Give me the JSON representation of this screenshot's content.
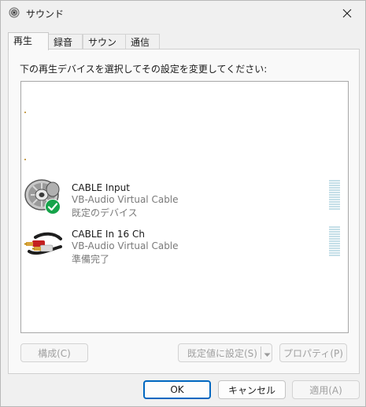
{
  "window": {
    "title": "サウンド",
    "title_icon": "speaker-icon",
    "close_icon": "close-icon"
  },
  "tabs": [
    {
      "label": "再生",
      "active": true
    },
    {
      "label": "録音",
      "active": false
    },
    {
      "label": "サウンド",
      "active": false
    },
    {
      "label": "通信",
      "active": false
    }
  ],
  "panel": {
    "instruction": "下の再生デバイスを選択してその設定を変更してください:"
  },
  "devices": [
    {
      "name": "CABLE Input",
      "description": "VB-Audio Virtual Cable",
      "status": "既定のデバイス",
      "icon": "speaker-icon",
      "badge_icon": "check-badge-icon"
    },
    {
      "name": "CABLE In 16 Ch",
      "description": "VB-Audio Virtual Cable",
      "status": "準備完了",
      "icon": "rca-cable-icon"
    }
  ],
  "panel_buttons": {
    "configure": "構成(C)",
    "set_default": "既定値に設定(S)",
    "properties": "プロパティ(P)"
  },
  "dialog_buttons": {
    "ok": "OK",
    "cancel": "キャンセル",
    "apply": "適用(A)"
  },
  "colors": {
    "accent": "#0067c0",
    "check_green": "#16a34a",
    "meter": "#c5dfe8"
  }
}
